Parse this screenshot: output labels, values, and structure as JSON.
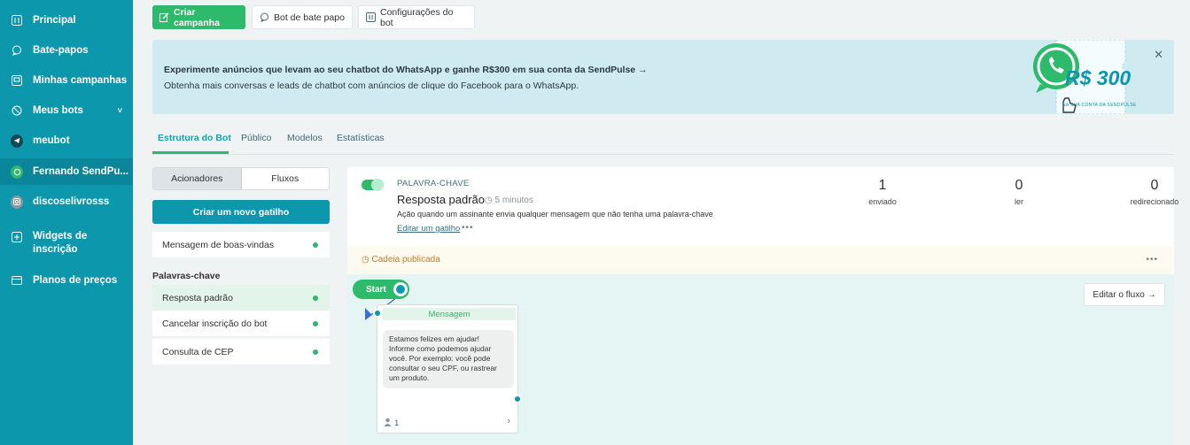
{
  "sidebar": {
    "items": [
      {
        "label": "Principal",
        "icon": "dashboard-icon"
      },
      {
        "label": "Bate-papos",
        "icon": "chat-icon"
      },
      {
        "label": "Minhas campanhas",
        "icon": "campaigns-icon"
      },
      {
        "label": "Meus bots",
        "icon": "bots-icon"
      },
      {
        "label": "meubot",
        "icon": "telegram-icon"
      },
      {
        "label": "Fernando SendPu...",
        "icon": "whatsapp-icon"
      },
      {
        "label": "discoselivrosss",
        "icon": "instagram-icon"
      },
      {
        "label_line1": "Widgets de",
        "label_line2": "inscrição",
        "icon": "widgets-icon"
      },
      {
        "label": "Planos de preços",
        "icon": "pricing-icon"
      }
    ]
  },
  "toolbar": {
    "create_campaign": "Criar campanha",
    "chat_bot": "Bot de bate papo",
    "bot_settings": "Configurações do bot"
  },
  "banner": {
    "title": "Experimente anúncios que levam ao seu chatbot do WhatsApp e ganhe R$300 em sua conta da SendPulse →",
    "subtitle": "Obtenha mais conversas e leads de chatbot com anúncios de clique do Facebook para o WhatsApp.",
    "ticket_amount": "R$ 300",
    "ticket_small": "NA SUA CONTA DA SENDPULSE"
  },
  "tabs": [
    "Estrutura do Bot",
    "Público",
    "Modelos",
    "Estatísticas"
  ],
  "left": {
    "seg_triggers": "Acionadores",
    "seg_flows": "Fluxos",
    "new_trigger": "Criar um novo gatilho",
    "welcome": "Mensagem de boas-vindas",
    "keywords_label": "Palavras-chave",
    "keywords": [
      "Resposta padrão",
      "Cancelar inscrição do bot",
      "Consulta de CEP"
    ]
  },
  "trigger": {
    "kind": "PALAVRA-CHAVE",
    "title": "Resposta padrão",
    "time": "5 minutos",
    "description": "Ação quando um assinante envia qualquer mensagem que não tenha uma palavra-chave",
    "edit_link": "Editar um gatilho",
    "stats": [
      {
        "value": "1",
        "label": "enviado"
      },
      {
        "value": "0",
        "label": "ler"
      },
      {
        "value": "0",
        "label": "redirecionado"
      }
    ],
    "published": "Cadeia publicada"
  },
  "flow": {
    "start": "Start",
    "edit_flow": "Editar o fluxo →",
    "node_header": "Mensagem",
    "message_lines": [
      "Estamos felizes em ajudar!",
      "Informe como podemos ajudar",
      "você. Por exemplo: você pode",
      "consultar o seu CPF, ou rastrear",
      "um produto."
    ],
    "node_count": "1"
  },
  "colors": {
    "sidebar": "#0c97ad",
    "accent_green": "#2dba6b",
    "banner_bg": "#cfeaf0"
  }
}
